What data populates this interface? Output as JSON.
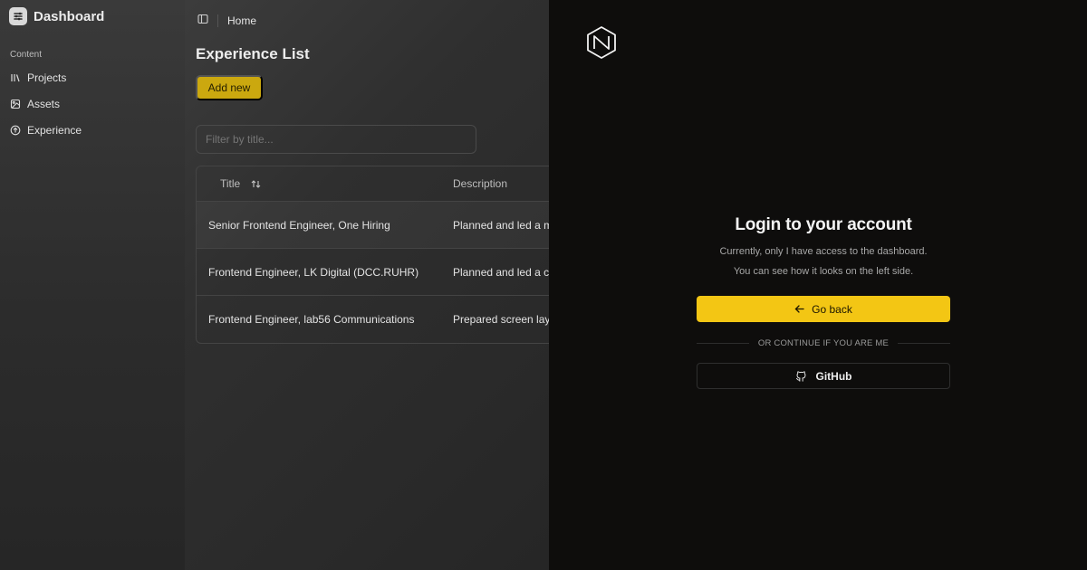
{
  "sidebar": {
    "brand_title": "Dashboard",
    "brand_icon": "dashboard-icon",
    "section_label": "Content",
    "items": [
      {
        "label": "Projects",
        "icon": "library-icon"
      },
      {
        "label": "Assets",
        "icon": "image-icon"
      },
      {
        "label": "Experience",
        "icon": "arrow-up-circle-icon"
      }
    ]
  },
  "header": {
    "toggle_icon": "panel-left-icon",
    "breadcrumb": "Home"
  },
  "main": {
    "title": "Experience List",
    "add_button": "Add new",
    "filter_placeholder": "Filter by title...",
    "table": {
      "columns": [
        "Title",
        "Description"
      ],
      "sort_icon": "sort-arrows-icon",
      "rows": [
        {
          "title": "Senior Frontend Engineer, One Hiring",
          "description": "Planned and led a m"
        },
        {
          "title": "Frontend Engineer, LK Digital (DCC.RUHR)",
          "description": "Planned and led a c"
        },
        {
          "title": "Frontend Engineer, lab56 Communications",
          "description": "Prepared screen lay"
        }
      ]
    }
  },
  "login": {
    "logo_icon": "hexagon-logo-icon",
    "title": "Login to your account",
    "subtitle_line1": "Currently, only I have access to the dashboard.",
    "subtitle_line2": "You can see how it looks on the left side.",
    "go_back_label": "Go back",
    "go_back_icon": "arrow-left-icon",
    "divider_text": "OR CONTINUE IF YOU ARE ME",
    "github_label": "GitHub",
    "github_icon": "github-icon"
  },
  "colors": {
    "accent": "#f3c614",
    "panel_bg": "#0e0d0c",
    "sidebar_bg": "#2e2e2e"
  }
}
